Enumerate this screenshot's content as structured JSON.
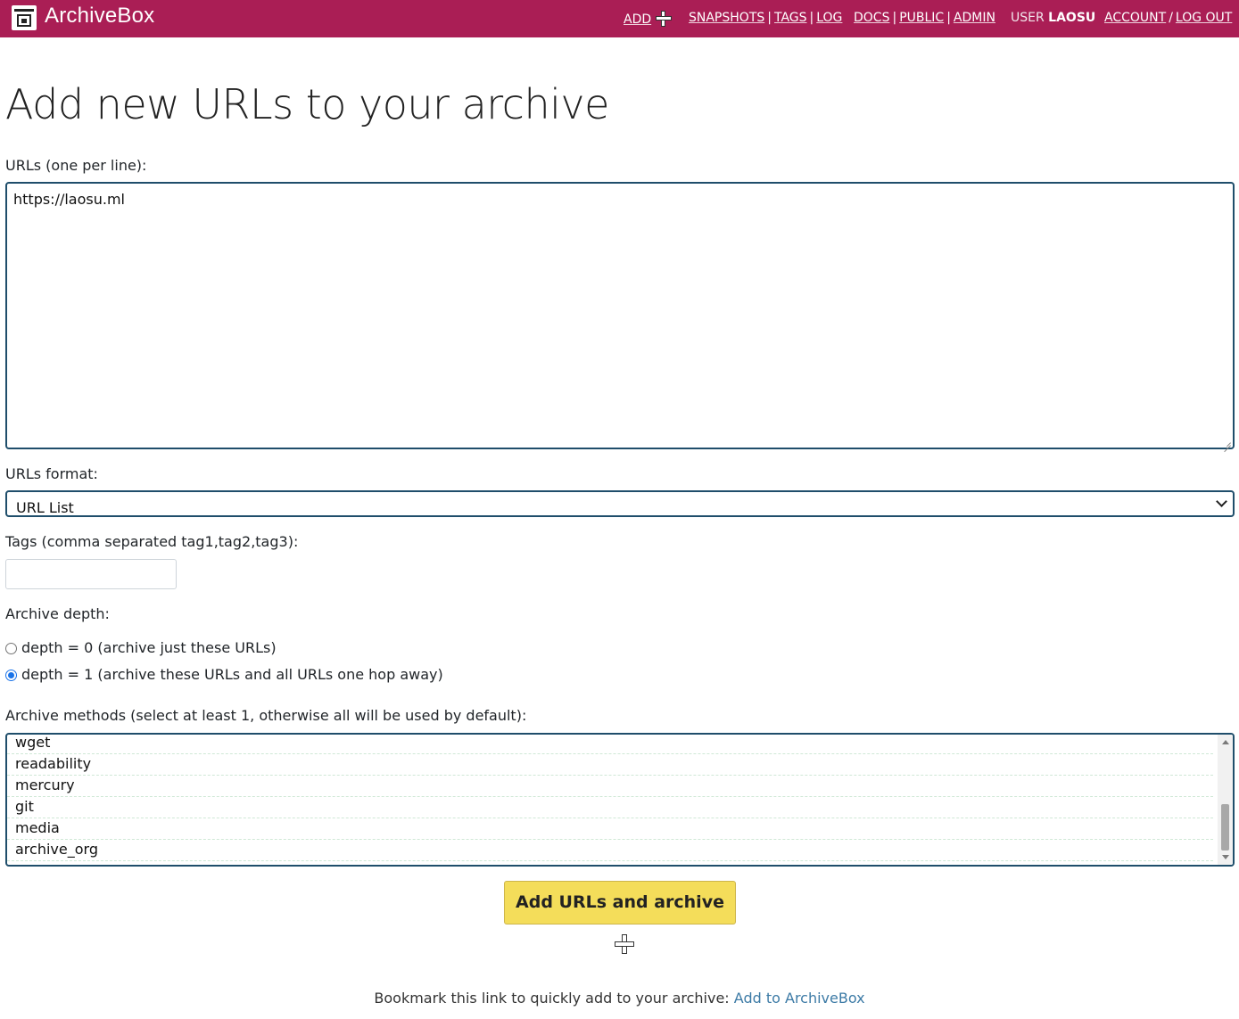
{
  "header": {
    "brand": "ArchiveBox",
    "nav": {
      "add": "ADD",
      "snapshots": "SNAPSHOTS",
      "tags": "TAGS",
      "log": "LOG",
      "docs": "DOCS",
      "public": "PUBLIC",
      "admin": "ADMIN",
      "user_prefix": "USER",
      "username": "LAOSU",
      "account": "ACCOUNT",
      "logout": "LOG OUT"
    },
    "colors": {
      "background": "#aa1e55"
    }
  },
  "page": {
    "title": "Add new URLs to your archive"
  },
  "form": {
    "urls_label": "URLs (one per line):",
    "urls_value": "https://laosu.ml",
    "format_label": "URLs format:",
    "format_value": "URL List",
    "tags_label": "Tags (comma separated tag1,tag2,tag3):",
    "tags_value": "",
    "depth_label": "Archive depth:",
    "depth_options": [
      {
        "label": "depth = 0 (archive just these URLs)",
        "selected": false
      },
      {
        "label": "depth = 1 (archive these URLs and all URLs one hop away)",
        "selected": true
      }
    ],
    "methods_label": "Archive methods (select at least 1, otherwise all will be used by default):",
    "methods": [
      "wget",
      "readability",
      "mercury",
      "git",
      "media",
      "archive_org"
    ],
    "submit_label": "Add URLs and archive",
    "submit_color": "#f4dd5a"
  },
  "footer": {
    "text": "Bookmark this link to quickly add to your archive:",
    "link": "Add to ArchiveBox"
  }
}
